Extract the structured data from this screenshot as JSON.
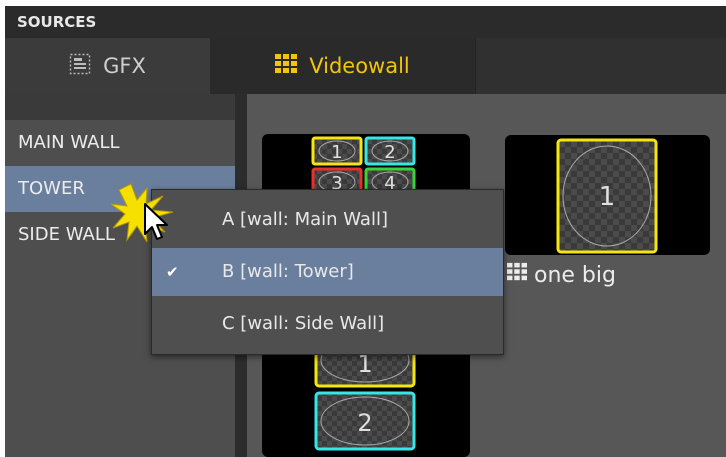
{
  "header": {
    "title": "SOURCES"
  },
  "tabs": [
    {
      "label": "GFX",
      "icon": "gfx-icon"
    },
    {
      "label": "Videowall",
      "icon": "videowall-grid-icon"
    }
  ],
  "sidebar": {
    "items": [
      {
        "label": "MAIN WALL"
      },
      {
        "label": "TOWER"
      },
      {
        "label": "SIDE WALL"
      }
    ],
    "selected": "TOWER"
  },
  "cards": [
    {
      "tiles_top": [
        "1",
        "2",
        "3",
        "4"
      ],
      "tiles_bottom": [
        "1",
        "2"
      ]
    },
    {
      "tile": "1",
      "label": "one big"
    }
  ],
  "context_menu": {
    "items": [
      {
        "label": "A [wall: Main Wall]",
        "checked": false
      },
      {
        "label": "B [wall: Tower]",
        "checked": true
      },
      {
        "label": "C [wall: Side Wall]",
        "checked": false
      }
    ]
  },
  "colors": {
    "accent": "#f2c40c",
    "selection": "#6a7f9d",
    "tile_yellow": "#f5e60f",
    "tile_cyan": "#39e6e6",
    "tile_red": "#e8302d",
    "tile_green": "#3ad43a"
  }
}
